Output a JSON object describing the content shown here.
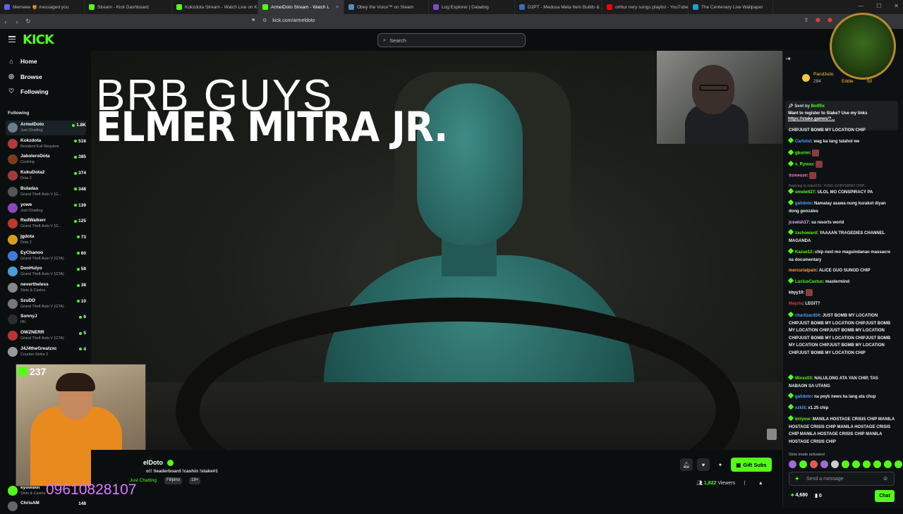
{
  "browser": {
    "tabs": [
      {
        "label": "Memeee 🍯 messaged you",
        "color": "#5865f2"
      },
      {
        "label": "Stream - Kick Dashboard",
        "color": "#53fc18"
      },
      {
        "label": "Kokzdota Stream - Watch Live on Ki...",
        "color": "#53fc18"
      },
      {
        "label": "ArmelDoto Stream - Watch L",
        "color": "#53fc18",
        "active": true
      },
      {
        "label": "Obey the Voice™ on Steam",
        "color": "#4a90c8"
      },
      {
        "label": "Log Explorer | Datadog",
        "color": "#7b4cc7"
      },
      {
        "label": "D2PT - Medusa Meta Item Builds & ...",
        "color": "#3b6db8"
      },
      {
        "label": "orthur nery songs playlist - YouTube",
        "color": "#ff0000"
      },
      {
        "label": "The Centenary Live Wallpaper",
        "color": "#1e9bd7"
      }
    ],
    "url": "kick.com/armeldoto"
  },
  "header": {
    "logo": "KICK",
    "search_placeholder": "Search"
  },
  "sidebar": {
    "nav": [
      {
        "label": "Home",
        "icon": "home-icon"
      },
      {
        "label": "Browse",
        "icon": "compass-icon"
      },
      {
        "label": "Following",
        "icon": "heart-icon"
      }
    ],
    "following_heading": "Following",
    "channels": [
      {
        "name": "ArmelDoto",
        "category": "Just Chatting",
        "viewers": "1.8K",
        "color": "#6a7f8c"
      },
      {
        "name": "Kokzdota",
        "category": "Resident Evil Requiem",
        "viewers": "516",
        "color": "#b23b3b"
      },
      {
        "name": "JaboleroDota",
        "category": "Cooking",
        "viewers": "385",
        "color": "#7c3b1f"
      },
      {
        "name": "KukuDota2",
        "category": "Dota 2",
        "viewers": "374",
        "color": "#a43a3a"
      },
      {
        "name": "Buladas",
        "category": "Grand Theft Auto V (G...",
        "viewers": "348",
        "color": "#555"
      },
      {
        "name": "yowe",
        "category": "Just Chatting",
        "viewers": "139",
        "color": "#8a48c0"
      },
      {
        "name": "RedWalkerr",
        "category": "Grand Theft Auto V (G...",
        "viewers": "125",
        "color": "#c0392b"
      },
      {
        "name": "jgdota",
        "category": "Dota 2",
        "viewers": "73",
        "color": "#d4a017"
      },
      {
        "name": "EyChanoo",
        "category": "Grand Theft Auto V (GTA)",
        "viewers": "60",
        "color": "#3b7dd8"
      },
      {
        "name": "DonHulyo",
        "category": "Grand Theft Auto V (GTA)",
        "viewers": "58",
        "color": "#4a9fd8"
      },
      {
        "name": "nevertheless",
        "category": "Slots & Casino",
        "viewers": "38",
        "color": "#888"
      },
      {
        "name": "SzuDD",
        "category": "Grand Theft Auto V (GTA)",
        "viewers": "10",
        "color": "#777"
      },
      {
        "name": "SonnyJ",
        "category": "IRL",
        "viewers": "6",
        "color": "#2d2d2d"
      },
      {
        "name": "OWZNERR",
        "category": "Grand Theft Auto V (GTA)",
        "viewers": "5",
        "color": "#b33"
      },
      {
        "name": "J4J4theGreatzxc",
        "category": "Counter-Strike 2",
        "viewers": "4",
        "color": "#999"
      }
    ],
    "bottom_channels": [
      {
        "name": "kyootbot",
        "category": "Slots & Casino",
        "viewers": "",
        "color": "#53fc18"
      },
      {
        "name": "ChrisAM",
        "category": "",
        "viewers": "148",
        "color": "#666"
      }
    ]
  },
  "player": {
    "overlay_line1": "BRB GUYS",
    "overlay_line2": "ELMER MITRA JR.",
    "cam_viewers": "237",
    "phone": "09610828107"
  },
  "stream_info": {
    "streamer": "elDoto",
    "title": "o!! !leaderboard !cashin !stake#1",
    "category": "Just Chatting",
    "tags": [
      "Filipino",
      "18+"
    ],
    "gift_subs": "Gift Subs",
    "viewers_count": "1,822",
    "viewers_label": "Viewers"
  },
  "chat": {
    "top_gifter_1": "Pand3silo",
    "top_gifter_1_count": "284",
    "top_gifter_2": "Eddie",
    "top_gifter_2_count": "50",
    "pinned": {
      "sent_by": "Sent by",
      "bot": "BotRix",
      "message": "Want to register to Stake? Use my links",
      "link": "https://stake.games/?..."
    },
    "messages": [
      {
        "user": "",
        "color": "#fff",
        "text": "CHIPJUST BOMB MY LOCATION CHIP"
      },
      {
        "user": "Carlotoi",
        "color": "#4aa3ff",
        "text": "wag ka lang tatahol we"
      },
      {
        "user": "gburnn",
        "color": "#53fc18",
        "text": ""
      },
      {
        "user": "x_Ryuuu",
        "color": "#53fc18",
        "text": ""
      },
      {
        "user": "itsmeoze",
        "color": "#ff7ab8",
        "text": ""
      },
      {
        "user": "",
        "color": "#777",
        "text": "Replying to mikel101: YUNG GOBYERNO CHIP..."
      },
      {
        "user": "omelett27",
        "color": "#53fc18",
        "text": "ULOL MO CONSPIRACY PA"
      },
      {
        "user": "galidoto",
        "color": "#4aa3ff",
        "text": "Namatay asawa nung kurakot diyan dong gonzales"
      },
      {
        "user": "jcswish17",
        "color": "#e3b0ff",
        "text": "sa resorts world"
      },
      {
        "user": "zxchoward",
        "color": "#53fc18",
        "text": "YAAAAN TRAGEDIES CHANNEL MAGANDA"
      },
      {
        "user": "Kazue12",
        "color": "#53fc18",
        "text": "chip next mo maguindanao massacre na documentary"
      },
      {
        "user": "mercurialpain",
        "color": "#ff9f43",
        "text": "ALICE GUO SUNOD CHIP"
      },
      {
        "user": "LuciusCastus",
        "color": "#53fc18",
        "text": "mastermind"
      },
      {
        "user": "kbyy10",
        "color": "#ffffff",
        "text": ""
      },
      {
        "user": "Mayzia",
        "color": "#e03a3a",
        "text": "LEGIT?"
      },
      {
        "user": "charlizard04",
        "color": "#4aa3ff",
        "text": "JUST BOMB MY LOCATION CHIPJUST BOMB MY LOCATION CHIPJUST BOMB MY LOCATION CHIPJUST BOMB MY LOCATION CHIPJUST BOMB MY LOCATION CHIPJUST BOMB MY LOCATION CHIPJUST BOMB MY LOCATION CHIPJUST BOMB MY LOCATION CHIP"
      },
      {
        "user": "Minxx03",
        "color": "#53fc18",
        "text": "NALULONG ATA YAN CHIP, TAS NABAON SA UTANG"
      },
      {
        "user": "galidoto",
        "color": "#4aa3ff",
        "text": "na peyk news ka lang ata chup"
      },
      {
        "user": "xzkill",
        "color": "#4aa3ff",
        "text": "x1.25 chip"
      },
      {
        "user": "briiyow",
        "color": "#53fc18",
        "text": "MANILA HOSTAGE CRISIS CHIP MANILA HOSTAGE CRISIS CHIP MANILA HOSTAGE CRISIS CHIP MANILA HOSTAGE CRISIS CHIP MANILA HOSTAGE CRISIS CHIP"
      }
    ],
    "slow_mode": "Slow mode activated",
    "input_placeholder": "Send a message",
    "points": "4,680",
    "points2": "0",
    "chat_button": "Chat"
  },
  "colors": {
    "accent": "#53fc18",
    "bg": "#0b0e0f"
  }
}
